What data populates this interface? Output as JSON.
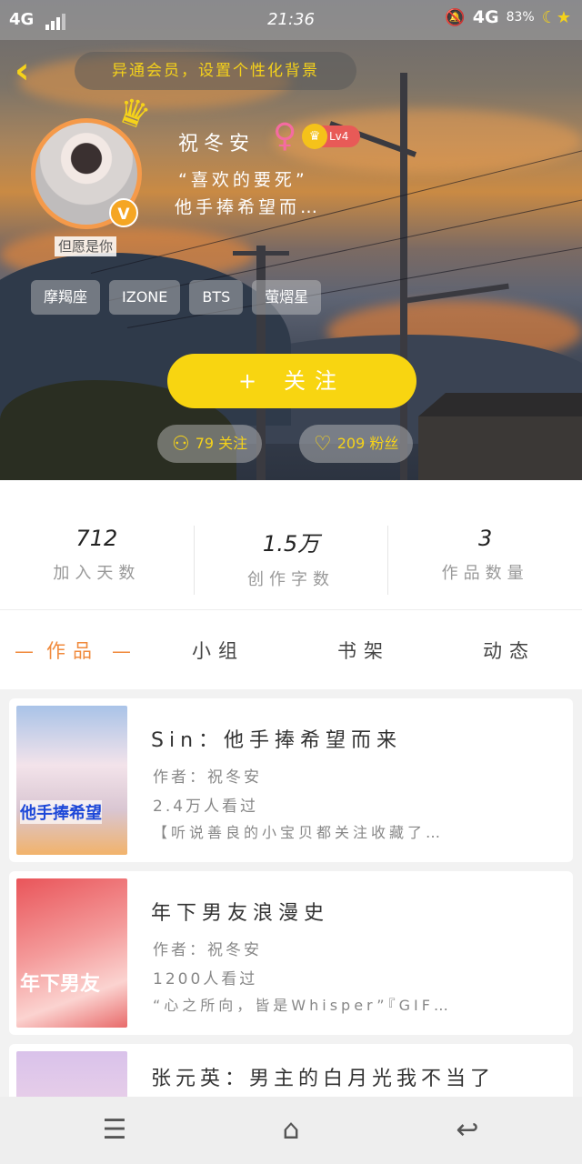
{
  "status_bar": {
    "network_left": "4G",
    "time": "21:36",
    "network_right": "4G",
    "battery": "83%"
  },
  "header": {
    "background_tip": "异通会员，设置个性化背景"
  },
  "profile": {
    "name": "祝冬安",
    "gender_symbol": "♀",
    "level": "Lv4",
    "signature_line1": "“喜欢的要死”",
    "signature_line2": "他手捧希望而…",
    "motto": "但愿是你",
    "tags": [
      "摩羯座",
      "IZONE",
      "BTS",
      "萤熠星"
    ],
    "follow_label": "关注",
    "follow_plus": "+",
    "following_count": "79 关注",
    "fans_count": "209 粉丝"
  },
  "stats": [
    {
      "value": "712",
      "label": "加入天数"
    },
    {
      "value": "1.5万",
      "label": "创作字数"
    },
    {
      "value": "3",
      "label": "作品数量"
    }
  ],
  "tabs": [
    "作品",
    "小组",
    "书架",
    "动态"
  ],
  "works": [
    {
      "title": "Sin：他手捧希望而来",
      "author": "作者：祝冬安",
      "views": "2.4万人看过",
      "desc": "【听说善良的小宝贝都关注收藏了…",
      "cover_text": "他手捧希望"
    },
    {
      "title": "年下男友浪漫史",
      "author": "作者：祝冬安",
      "views": "1200人看过",
      "desc": "“心之所向，皆是Whisper”『GIF…",
      "cover_text": "年下男友"
    },
    {
      "title": "张元英：男主的白月光我不当了",
      "author": "",
      "views": "",
      "desc": "",
      "cover_text": ""
    }
  ],
  "colors": {
    "accent_yellow": "#f8d511",
    "accent_orange": "#f08a3c",
    "level_red": "#e85a57"
  }
}
